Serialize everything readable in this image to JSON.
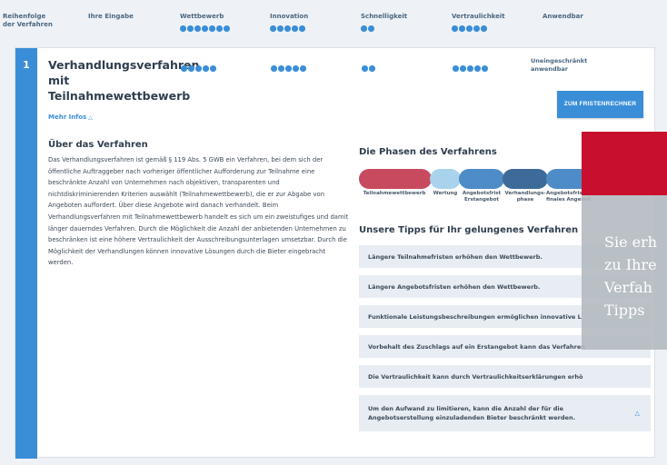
{
  "header": {
    "columns": [
      {
        "label": "Reihenfolge der Verfahren"
      },
      {
        "label": "Ihre Eingabe"
      },
      {
        "label": "Wettbewerb",
        "dots": 7
      },
      {
        "label": "Innovation",
        "dots": 5
      },
      {
        "label": "Schnelligkeit",
        "dots": 2
      },
      {
        "label": "Vertraulichkeit",
        "dots": 5
      },
      {
        "label": "Anwendbar"
      }
    ]
  },
  "procedure": {
    "number": "1",
    "title": "Verhandlungsverfahren mit Teilnahmewettbewerb",
    "ratings": {
      "wettbewerb": 5,
      "innovation": 5,
      "schnelligkeit": 2,
      "vertraulichkeit": 5
    },
    "usability": "Uneingeschränkt anwendbar",
    "fristen_button": "ZUM FRISTENRECHNER",
    "more_info": "Mehr Infos"
  },
  "about": {
    "title": "Über das Verfahren",
    "text": "Das Verhandlungsverfahren ist gemäß § 119 Abs. 5 GWB ein Verfahren, bei dem sich der öffentliche Auftraggeber nach vorheriger öffentlicher Aufforderung zur Teilnahme eine beschränkte Anzahl von Unternehmen nach objektiven, transparenten und nichtdiskriminierenden Kriterien auswählt (Teilnahmewettbewerb), die er zur Abgabe von Angeboten auffordert. Über diese Angebote wird danach verhandelt. Beim Verhandlungsverfahren mit Teilnahmewettbewerb handelt es sich um ein zweistufiges und damit länger dauerndes Verfahren. Durch die Möglichkeit die Anzahl der anbietenden Unternehmen zu beschränken ist eine höhere Vertraulichkeit der Ausschreibungsunterlagen umsetzbar. Durch die Möglichkeit der Verhandlungen können innovative Lösungen durch die Bieter eingebracht werden."
  },
  "phases": {
    "title": "Die Phasen des Verfahrens",
    "items": [
      {
        "label": "Teilnahmewettbewerb",
        "color": "#c84a5e"
      },
      {
        "label": "Wertung",
        "color": "#a9d2ec"
      },
      {
        "label": "Angebotsfrist Erstangebot",
        "color": "#4e8cc8"
      },
      {
        "label": "Verhandlungs-phase",
        "color": "#3e6a9a"
      },
      {
        "label": "Angebotsfrist finales Angebot",
        "color": "#4e8cc8"
      }
    ]
  },
  "tips": {
    "title": "Unsere Tipps für Ihr gelungenes Verfahren",
    "items": [
      "Längere Teilnahmefristen erhöhen den Wettbewerb.",
      "Längere Angebotsfristen erhöhen den Wettbewerb.",
      "Funktionale Leistungsbeschreibungen ermöglichen innovative L",
      "Vorbehalt des Zuschlags auf ein Erstangebot kann das Verfahren",
      "Die Vertraulichkeit kann durch Vertraulichkeitserklärungen erhö",
      "Um den Aufwand zu limitieren, kann die Anzahl der für die Angebotserstellung einzuladenden Bieter beschränkt werden."
    ]
  },
  "overlay": {
    "lines": [
      "Sie erh",
      "zu Ihre",
      "Verfah",
      "Tipps "
    ]
  },
  "colors": {
    "accent": "#3a8ed8",
    "overlay_red": "#c8102e",
    "tip_bg": "#e7edf3"
  }
}
